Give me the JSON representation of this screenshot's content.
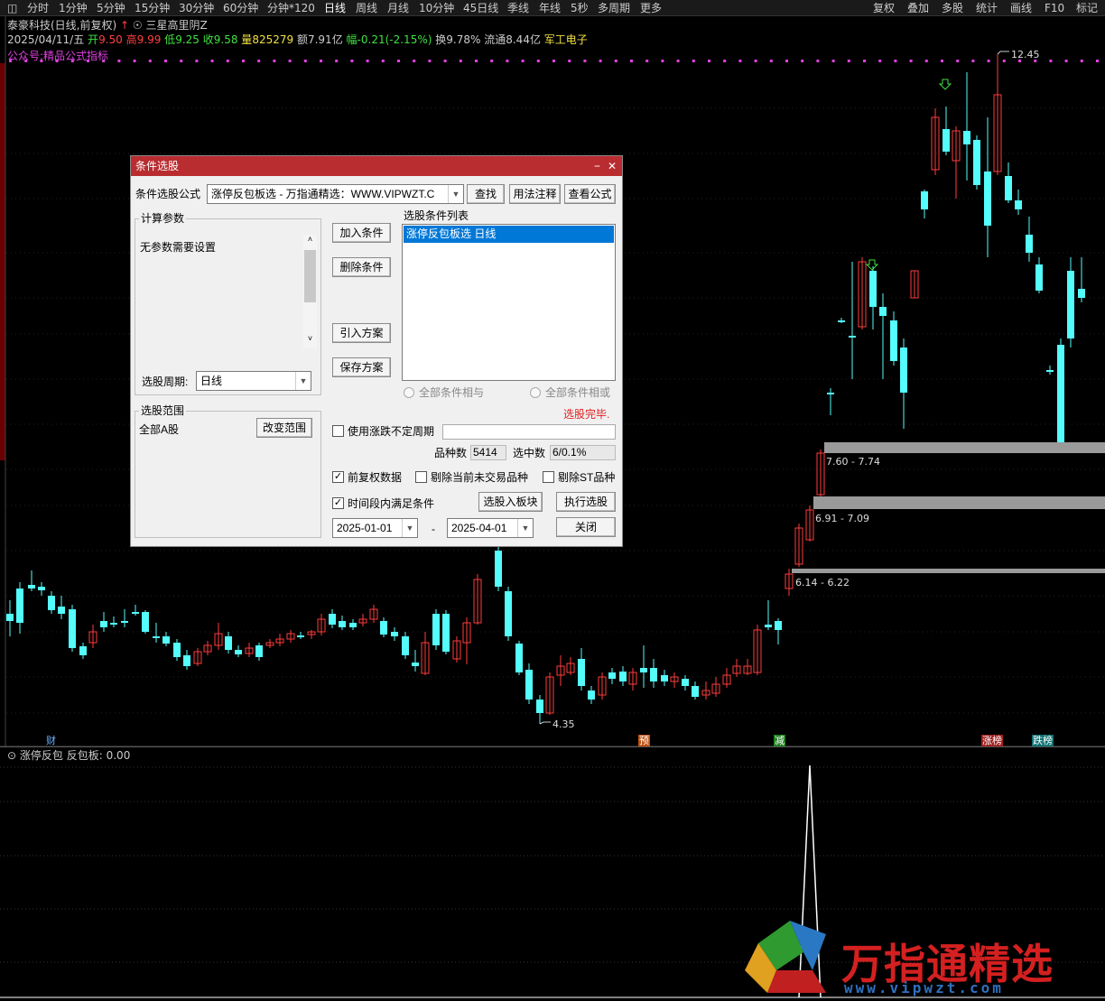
{
  "toolbar": {
    "items": [
      "分时",
      "1分钟",
      "5分钟",
      "15分钟",
      "30分钟",
      "60分钟",
      "分钟*120",
      "日线",
      "周线",
      "月线",
      "10分钟",
      "45日线",
      "季线",
      "年线",
      "5秒",
      "多周期",
      "更多"
    ],
    "active": "日线",
    "right_items": [
      "复权",
      "叠加",
      "多股",
      "统计",
      "画线",
      "F10",
      "标记"
    ]
  },
  "stock": {
    "name": "泰豪科技(日线,前复权)",
    "pattern": "三星高里阴Z",
    "date": "2025/04/11/五",
    "open_label": "开",
    "open": "9.50",
    "high_label": "高",
    "high": "9.99",
    "low_label": "低",
    "low": "9.25",
    "close_label": "收",
    "close": "9.58",
    "volume_label": "量",
    "volume": "825279",
    "amount_label": "额",
    "amount": "7.91亿",
    "change_label": "幅",
    "change": "-0.21(-2.15%)",
    "turnover_label": "换",
    "turnover": "9.78%",
    "float_label": "流通",
    "float": "8.44亿",
    "sector": "军工电子",
    "indicator_source": "公众号:精品公式指标"
  },
  "price_chart": {
    "max_label": "12.45",
    "min_label": "4.35",
    "ranges": [
      "7.60 - 7.74",
      "6.91 - 7.09",
      "6.14 - 6.22"
    ],
    "events": [
      "财",
      "预",
      "减",
      "涨榜",
      "跌榜"
    ],
    "colors": {
      "up": "#ff3c3c",
      "down": "#54fcfc",
      "range_bar": "#9a9a9a",
      "dot": "#e040e0"
    }
  },
  "indicator_pane": {
    "title": "涨停反包",
    "value_label": "反包板:",
    "value": "0.00"
  },
  "dialog": {
    "title": "条件选股",
    "formula_label": "条件选股公式",
    "formula_value": "涨停反包板选  -  万指通精选：WWW.VIPWZT.C",
    "btn_find": "查找",
    "btn_usage": "用法注释",
    "btn_view": "查看公式",
    "calc_params_label": "计算参数",
    "calc_params_text": "无参数需要设置",
    "period_label": "选股周期:",
    "period_value": "日线",
    "btn_add": "加入条件",
    "btn_delete": "删除条件",
    "btn_import": "引入方案",
    "btn_save": "保存方案",
    "cond_list_label": "选股条件列表",
    "cond_items": [
      "涨停反包板选  日线"
    ],
    "radio_and": "全部条件相与",
    "radio_or": "全部条件相或",
    "status": "选股完毕.",
    "scope_label": "选股范围",
    "scope_value": "全部A股",
    "btn_change_scope": "改变范围",
    "chk_variable_period": "使用涨跌不定周期",
    "count_label": "品种数",
    "count_value": "5414",
    "selected_label": "选中数",
    "selected_value": "6/0.1%",
    "chk_forward_adjust": "前复权数据",
    "chk_exclude_untraded": "剔除当前未交易品种",
    "chk_exclude_st": "剔除ST品种",
    "chk_time_range": "时间段内满足条件",
    "btn_to_block": "选股入板块",
    "btn_execute": "执行选股",
    "date_from": "2025-01-01",
    "date_sep": "-",
    "date_to": "2025-04-01",
    "btn_close": "关闭"
  },
  "watermark": {
    "text": "万指通精选",
    "url": "www.vipwzt.com"
  }
}
